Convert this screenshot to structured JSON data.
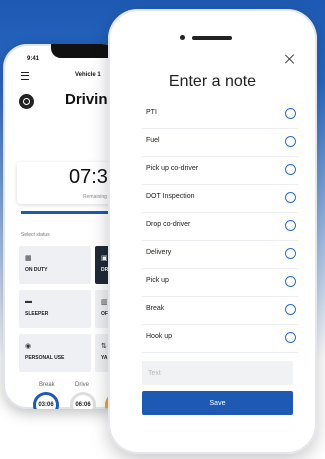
{
  "back_phone": {
    "time": "9:41",
    "vehicle_title": "Vehicle 1",
    "driving_title": "Drivin",
    "timer_value": "07:3",
    "timer_caption": "Remaining",
    "select_status_label": "Select status",
    "tiles": [
      {
        "icon": "calendar-icon",
        "glyph": "▦",
        "label": "ON DUTY"
      },
      {
        "icon": "truck-icon",
        "glyph": "▣",
        "label": "DR"
      },
      {
        "icon": "bed-icon",
        "glyph": "▬",
        "label": "SLEEPER"
      },
      {
        "icon": "power-icon",
        "glyph": "▥",
        "label": "OF"
      },
      {
        "icon": "location-pin-icon",
        "glyph": "◉",
        "label": "PERSONAL USE"
      },
      {
        "icon": "yard-move-icon",
        "glyph": "⇅",
        "label": "YA"
      }
    ],
    "dials": [
      {
        "label": "Break",
        "value": "03:06"
      },
      {
        "label": "Drive",
        "value": "06:06"
      }
    ]
  },
  "modal": {
    "title": "Enter a note",
    "items": [
      "PTI",
      "Fuel",
      "Pick up co-driver",
      "DOT Inspection",
      "Drop co-driver",
      "Delivery",
      "Pick up",
      "Break",
      "Hook up"
    ],
    "text_placeholder": "Text",
    "save_label": "Save"
  },
  "colors": {
    "accent": "#1e5ab3",
    "radio": "#2b6fc6",
    "dial_orange": "#f3a12c"
  }
}
